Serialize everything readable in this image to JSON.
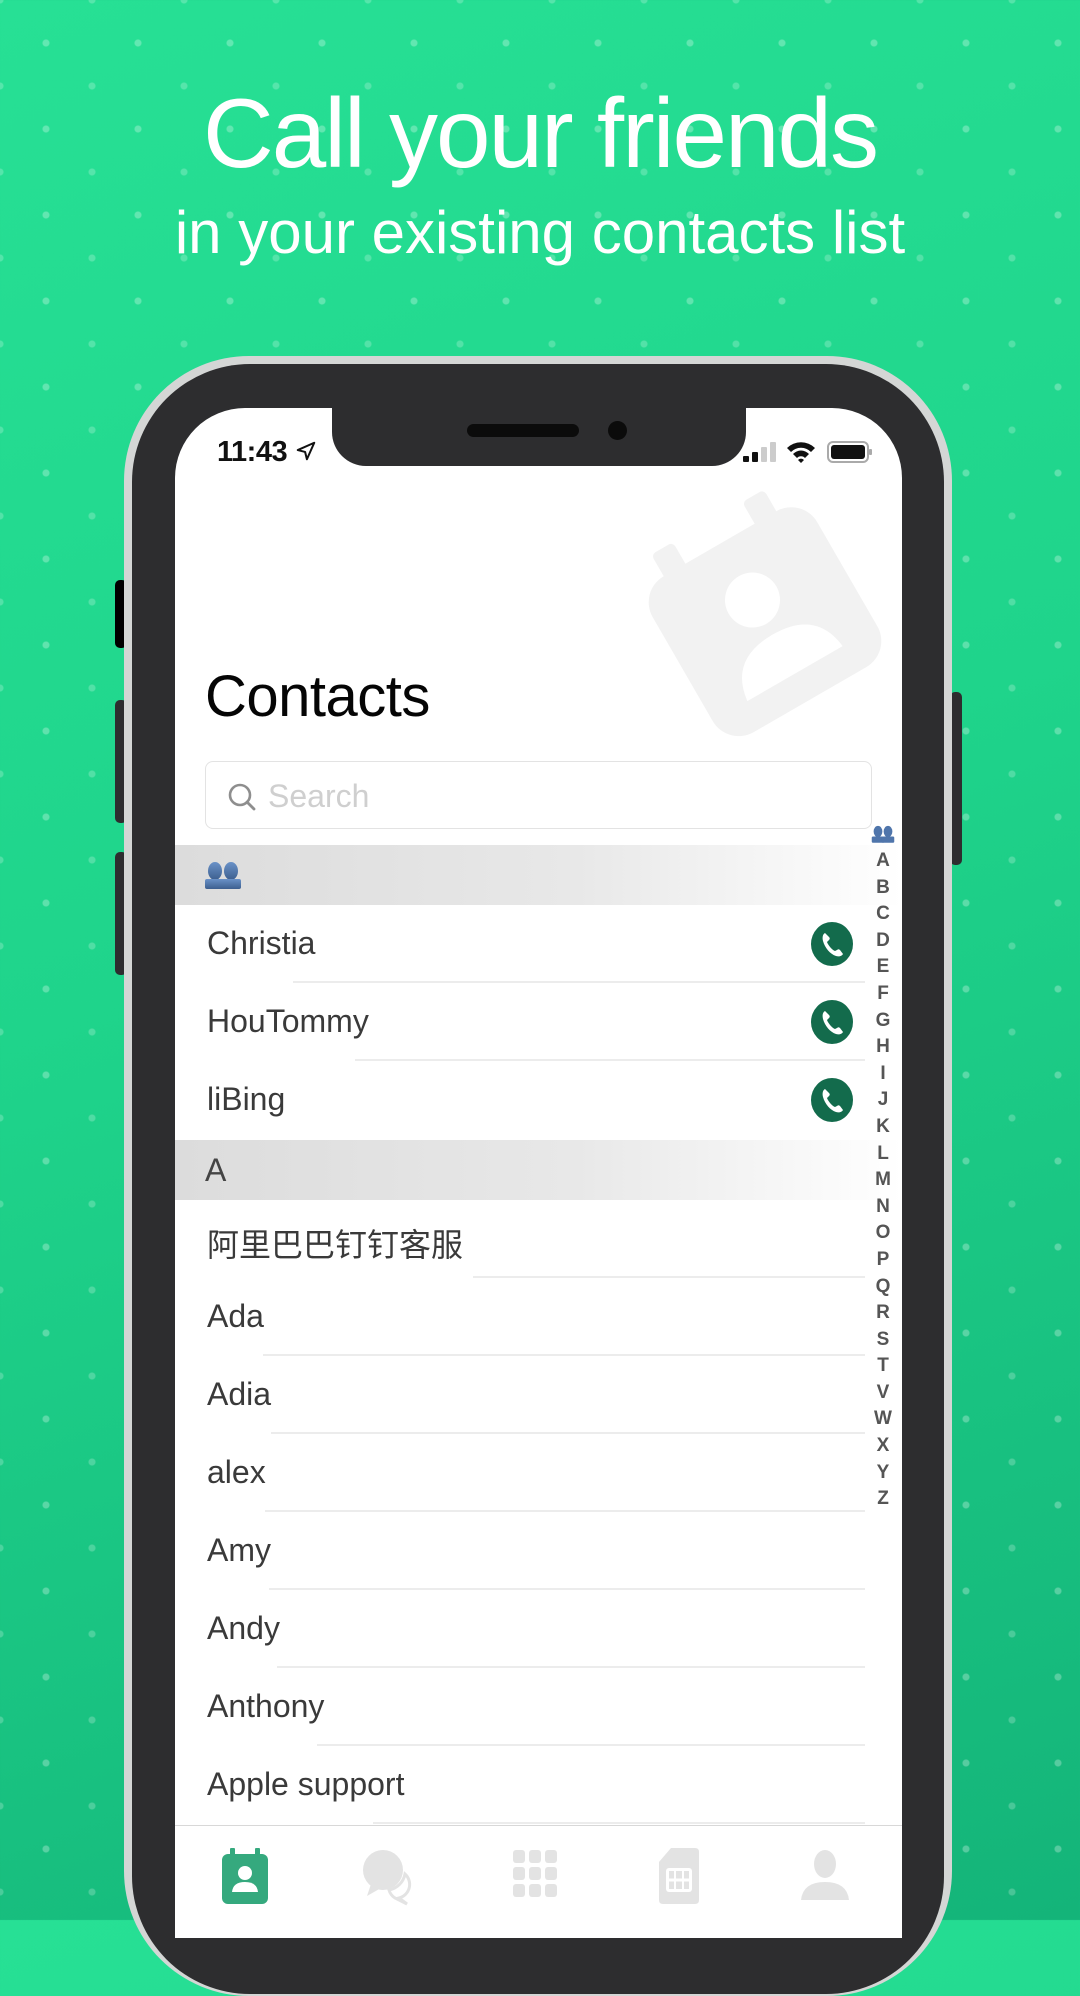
{
  "promo": {
    "headline": "Call your friends",
    "subheadline": "in your existing contacts list",
    "background_colors": [
      "#27e095",
      "#14b479"
    ]
  },
  "status_bar": {
    "time": "11:43",
    "icons": [
      "location-arrow-icon",
      "cellular-signal-icon",
      "wifi-icon",
      "battery-icon"
    ]
  },
  "screen": {
    "title": "Contacts",
    "search": {
      "placeholder": "Search",
      "value": ""
    },
    "sections": [
      {
        "header": "group-icon",
        "header_is_icon": true,
        "contacts": [
          {
            "name": "Christia",
            "call_button": true
          },
          {
            "name": "HouTommy",
            "call_button": true
          },
          {
            "name": "liBing",
            "call_button": true
          }
        ]
      },
      {
        "header": "A",
        "header_is_icon": false,
        "contacts": [
          {
            "name": "阿里巴巴钉钉客服",
            "call_button": false
          },
          {
            "name": "Ada",
            "call_button": false
          },
          {
            "name": "Adia",
            "call_button": false
          },
          {
            "name": "alex",
            "call_button": false
          },
          {
            "name": "Amy",
            "call_button": false
          },
          {
            "name": "Andy",
            "call_button": false
          },
          {
            "name": "Anthony",
            "call_button": false
          },
          {
            "name": "Apple support",
            "call_button": false
          }
        ]
      }
    ],
    "index_letters": [
      "A",
      "B",
      "C",
      "D",
      "E",
      "F",
      "G",
      "H",
      "I",
      "J",
      "K",
      "L",
      "M",
      "N",
      "O",
      "P",
      "Q",
      "R",
      "S",
      "T",
      "V",
      "W",
      "X",
      "Y",
      "Z"
    ],
    "call_color": "#136b4c",
    "accent_color": "#35a97e"
  },
  "tab_bar": {
    "tabs": [
      {
        "icon": "contacts-icon",
        "active": true
      },
      {
        "icon": "chat-icon",
        "active": false
      },
      {
        "icon": "dialpad-icon",
        "active": false
      },
      {
        "icon": "sim-card-icon",
        "active": false
      },
      {
        "icon": "profile-icon",
        "active": false
      }
    ]
  }
}
